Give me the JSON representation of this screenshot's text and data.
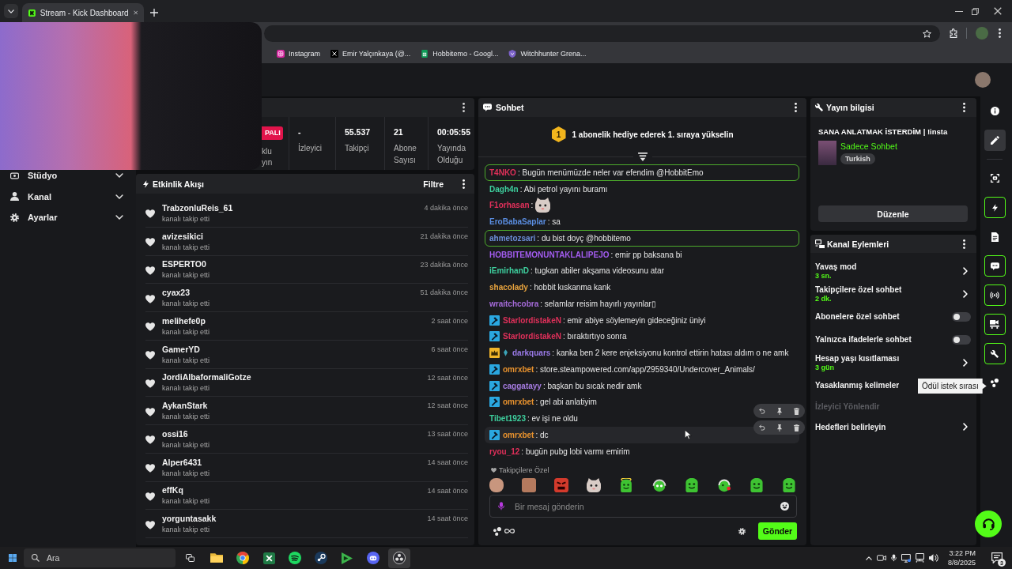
{
  "browser": {
    "tabs": [
      {
        "title": "Stream - Kick Dashboard",
        "selected": true
      }
    ],
    "bookmarks": [
      {
        "label": "Instagram"
      },
      {
        "label": "Emir Yalçınkaya (@..."
      },
      {
        "label": "Hobbitemo - Googl..."
      },
      {
        "label": "Witchhunter Grena..."
      }
    ]
  },
  "sidebar": {
    "items": [
      {
        "label": "Stüdyo",
        "expanded": false
      },
      {
        "label": "Kanal",
        "expanded": false
      },
      {
        "label": "Ayarlar",
        "expanded": false
      }
    ]
  },
  "stats": {
    "status_badge": "PALI",
    "status_label": "klu yın",
    "items": [
      {
        "value": "-",
        "label": "İzleyici"
      },
      {
        "value": "55.537",
        "label": "Takipçi"
      },
      {
        "value": "21",
        "label": "Abone Sayısı"
      },
      {
        "value": "00:05:55",
        "label": "Yayında Olduğu"
      }
    ]
  },
  "activity": {
    "title": "Etkinlik Akışı",
    "filter": "Filtre",
    "events": [
      {
        "user": "TrabzonluReis_61",
        "action": "kanalı takip etti",
        "time": "4 dakika önce"
      },
      {
        "user": "avizesikici",
        "action": "kanalı takip etti",
        "time": "21 dakika önce"
      },
      {
        "user": "ESPERTO0",
        "action": "kanalı takip etti",
        "time": "23 dakika önce"
      },
      {
        "user": "cyax23",
        "action": "kanalı takip etti",
        "time": "51 dakika önce"
      },
      {
        "user": "melihefe0p",
        "action": "kanalı takip etti",
        "time": "2 saat önce"
      },
      {
        "user": "GamerYD",
        "action": "kanalı takip etti",
        "time": "6 saat önce"
      },
      {
        "user": "JordiAlbaformaliGotze",
        "action": "kanalı takip etti",
        "time": "12 saat önce"
      },
      {
        "user": "AykanStark",
        "action": "kanalı takip etti",
        "time": "12 saat önce"
      },
      {
        "user": "ossi16",
        "action": "kanalı takip etti",
        "time": "13 saat önce"
      },
      {
        "user": "Alper6431",
        "action": "kanalı takip etti",
        "time": "14 saat önce"
      },
      {
        "user": "effKq",
        "action": "kanalı takip etti",
        "time": "14 saat önce"
      },
      {
        "user": "yorguntasakk",
        "action": "kanalı takip etti",
        "time": "14 saat önce"
      }
    ]
  },
  "chat": {
    "title": "Sohbet",
    "promo": {
      "rank": "1",
      "text": "1 abonelik hediye ederek 1. sıraya yükselin"
    },
    "messages": [
      {
        "kind": "text",
        "user": "T4NKO",
        "color": "#e0305a",
        "text": ": Bugün menümüzde neler var efendim @HobbitEmo",
        "highlighted": true,
        "hovered": false,
        "show_actions": false
      },
      {
        "kind": "text",
        "user": "Dagh4n",
        "color": "#3ecf9e",
        "text": ": Abi petrol yayını buramı",
        "highlighted": false,
        "hovered": false,
        "show_actions": false
      },
      {
        "kind": "emote",
        "user": "F1orhasan",
        "color": "#e0305a",
        "text": ":",
        "highlighted": false,
        "hovered": false,
        "show_actions": false
      },
      {
        "kind": "text",
        "user": "EroBabaSaplar",
        "color": "#5a8de0",
        "text": ": sa",
        "highlighted": false,
        "hovered": false,
        "show_actions": false
      },
      {
        "kind": "text",
        "user": "ahmetozsari",
        "color": "#6c8ed8",
        "text": ": du bist doyç @hobbitemo",
        "highlighted": true,
        "hovered": false,
        "show_actions": false
      },
      {
        "kind": "text",
        "user": "HOBBITEMONUNTAKLALIPEJO",
        "color": "#a35cf0",
        "text": ": emir pp baksana bi",
        "highlighted": false,
        "hovered": false,
        "show_actions": false
      },
      {
        "kind": "text",
        "user": "iEmirhanD",
        "color": "#3ecf9e",
        "text": ": tugkan abiler akşama videosunu atar",
        "highlighted": false,
        "hovered": false,
        "show_actions": false
      },
      {
        "kind": "text",
        "user": "shacolady",
        "color": "#e7a33e",
        "text": ": hobbit kıskanma kank",
        "highlighted": false,
        "hovered": false,
        "show_actions": false
      },
      {
        "kind": "text",
        "user": "wraitchcobra",
        "color": "#a46ad8",
        "text": ": selamlar reisim hayırlı yayınlar▯",
        "highlighted": false,
        "hovered": false,
        "show_actions": false
      },
      {
        "kind": "text",
        "badges": [
          {
            "kind": "moderator"
          }
        ],
        "user": "StarlordistakeN",
        "color": "#e0305a",
        "text": ": emir abiye söylemeyin gideceğiniz üniyi",
        "highlighted": false,
        "hovered": false,
        "show_actions": false
      },
      {
        "kind": "text",
        "badges": [
          {
            "kind": "moderator"
          }
        ],
        "user": "StarlordistakeN",
        "color": "#e0305a",
        "text": ": bıraktırtıyo sonra",
        "highlighted": false,
        "hovered": false,
        "show_actions": false
      },
      {
        "kind": "text",
        "badges": [
          {
            "kind": "crown"
          },
          {
            "kind": "gem"
          }
        ],
        "user": "darkquars",
        "color": "#9a7ae8",
        "text": ": kanka ben 2 kere enjeksiyonu kontrol ettirin hatası aldım o ne amk",
        "highlighted": false,
        "hovered": false,
        "show_actions": false
      },
      {
        "kind": "text",
        "badges": [
          {
            "kind": "moderator"
          }
        ],
        "user": "omrxbet",
        "color": "#e8922e",
        "text": ": store.steampowered.com/app/2959340/Undercover_Animals/",
        "highlighted": false,
        "hovered": false,
        "show_actions": false
      },
      {
        "kind": "text",
        "badges": [
          {
            "kind": "moderator"
          }
        ],
        "user": "caggatayy",
        "color": "#a57be0",
        "text": ": başkan bu sıcak nedir amk",
        "highlighted": false,
        "hovered": false,
        "show_actions": false
      },
      {
        "kind": "text",
        "badges": [
          {
            "kind": "moderator"
          }
        ],
        "user": "omrxbet",
        "color": "#e8922e",
        "text": ": gel abi anlatiyim",
        "highlighted": false,
        "hovered": false,
        "show_actions": false
      },
      {
        "kind": "text",
        "user": "Tibet1923",
        "color": "#3ecf9e",
        "text": ": ev işi ne oldu",
        "highlighted": false,
        "hovered": false,
        "show_actions": true
      },
      {
        "kind": "text",
        "badges": [
          {
            "kind": "moderator"
          }
        ],
        "user": "omrxbet",
        "color": "#e8922e",
        "text": ": dc",
        "highlighted": false,
        "hovered": true,
        "show_actions": true
      },
      {
        "kind": "text",
        "user": "ryou_12",
        "color": "#e0305a",
        "text": ": bugün pubg lobi varmı emirim",
        "highlighted": false,
        "hovered": false,
        "show_actions": false
      }
    ],
    "follower_emotes_label": "Takipçilere Özel",
    "input": {
      "placeholder": "Bir mesaj gönderin"
    },
    "send_button": "Gönder"
  },
  "stream_info": {
    "title": "Yayın bilgisi",
    "stream_title": "SANA ANLATMAK İSTERDİM | !insta",
    "category": "Sadece Sohbet",
    "tags": [
      "Turkish"
    ],
    "edit_button": "Düzenle"
  },
  "channel_actions": {
    "title": "Kanal Eylemleri",
    "items": [
      {
        "kind": "link",
        "label": "Yavaş mod",
        "value": "3 sn.",
        "disabled": false
      },
      {
        "kind": "link",
        "label": "Takipçilere özel sohbet",
        "value": "2 dk.",
        "disabled": false
      },
      {
        "kind": "toggle",
        "label": "Abonelere özel sohbet",
        "on": false,
        "disabled": false
      },
      {
        "kind": "toggle",
        "label": "Yalnızca ifadelerle sohbet",
        "on": false,
        "disabled": false
      },
      {
        "kind": "link",
        "label": "Hesap yaşı kısıtlaması",
        "value": "3 gün",
        "disabled": false
      },
      {
        "kind": "plain",
        "label": "Yasaklanmış kelimeler",
        "disabled": false
      },
      {
        "kind": "plain",
        "label": "İzleyici Yönlendir",
        "disabled": true
      },
      {
        "kind": "link",
        "label": "Hedefleri belirleyin",
        "disabled": false
      }
    ]
  },
  "rail": {
    "items": [
      {
        "selected": false,
        "active": false
      },
      {
        "selected": true,
        "active": false
      },
      {
        "selected": false,
        "active": false
      },
      {
        "selected": false,
        "active": true
      },
      {
        "selected": false,
        "active": false
      },
      {
        "selected": false,
        "active": true
      },
      {
        "selected": false,
        "active": true
      },
      {
        "selected": false,
        "active": true
      },
      {
        "selected": false,
        "active": true
      },
      {
        "selected": false,
        "active": false
      }
    ]
  },
  "tooltip": {
    "text": "Ödül istek sırası"
  },
  "taskbar": {
    "search_placeholder": "Ara",
    "apps": [
      {
        "active": false
      },
      {
        "active": false
      },
      {
        "active": false
      },
      {
        "active": false
      },
      {
        "active": false
      },
      {
        "active": false
      },
      {
        "active": false
      },
      {
        "active": true
      }
    ],
    "time": "3:22 PM",
    "date": "8/8/2025",
    "notification_count": "3"
  }
}
